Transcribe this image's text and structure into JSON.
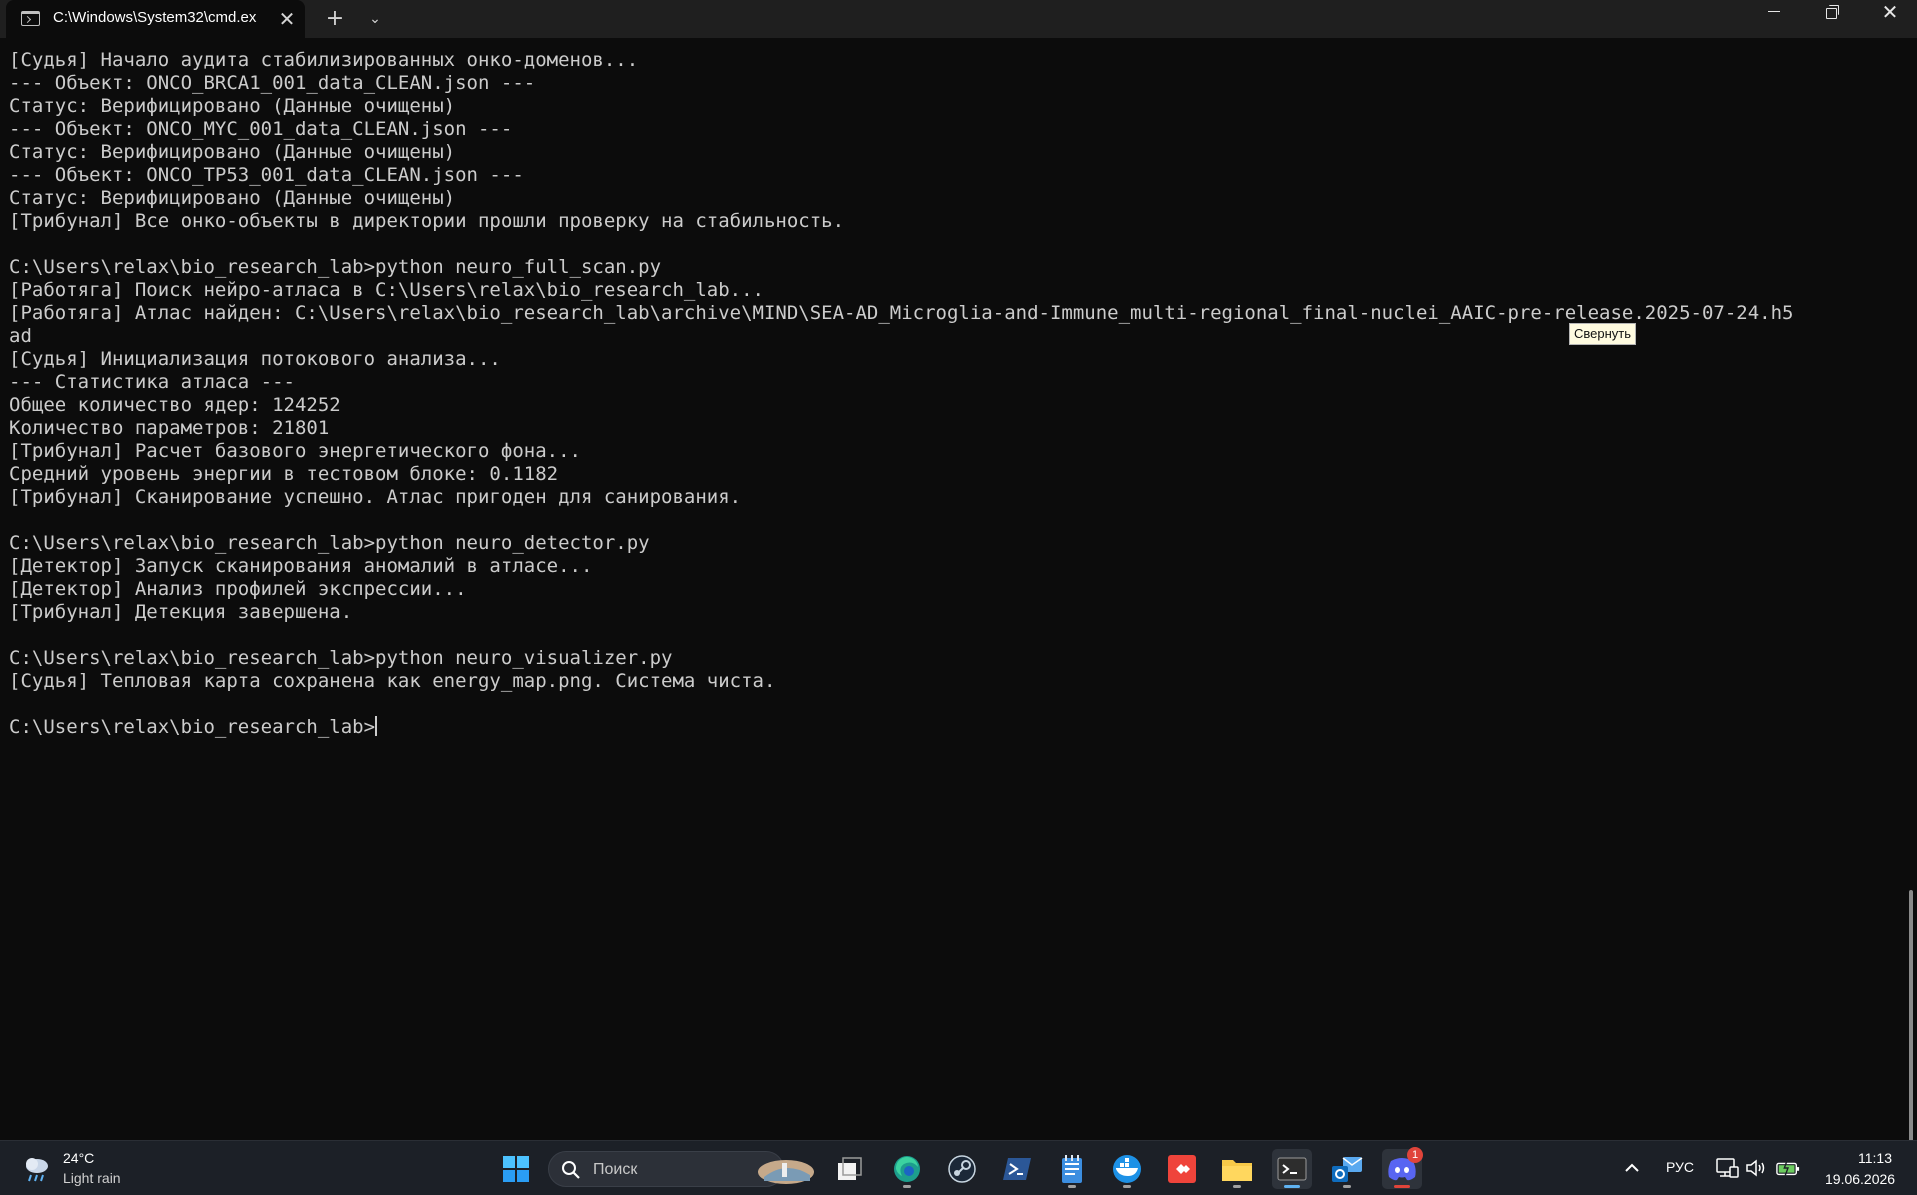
{
  "window": {
    "tab_title": "C:\\Windows\\System32\\cmd.ex",
    "close_glyph": "✕",
    "new_tab_glyph": "+",
    "dropdown_glyph": "⌄",
    "close_window_glyph": "✕"
  },
  "terminal": {
    "lines": [
      "[Судья] Начало аудита стабилизированных онко-доменов...",
      "--- Объект: ONCO_BRCA1_001_data_CLEAN.json ---",
      "Статус: Верифицировано (Данные очищены)",
      "--- Объект: ONCO_MYC_001_data_CLEAN.json ---",
      "Статус: Верифицировано (Данные очищены)",
      "--- Объект: ONCO_TP53_001_data_CLEAN.json ---",
      "Статус: Верифицировано (Данные очищены)",
      "[Трибунал] Все онко-объекты в директории прошли проверку на стабильность.",
      "",
      "C:\\Users\\relax\\bio_research_lab>python neuro_full_scan.py",
      "[Работяга] Поиск нейро-атласа в C:\\Users\\relax\\bio_research_lab...",
      "[Работяга] Атлас найден: C:\\Users\\relax\\bio_research_lab\\archive\\MIND\\SEA-AD_Microglia-and-Immune_multi-regional_final-nuclei_AAIC-pre-release.2025-07-24.h5",
      "ad",
      "[Судья] Инициализация потокового анализа...",
      "--- Статистика атласа ---",
      "Общее количество ядер: 124252",
      "Количество параметров: 21801",
      "[Трибунал] Расчет базового энергетического фона...",
      "Средний уровень энергии в тестовом блоке: 0.1182",
      "[Трибунал] Сканирование успешно. Атлас пригоден для санирования.",
      "",
      "C:\\Users\\relax\\bio_research_lab>python neuro_detector.py",
      "[Детектор] Запуск сканирования аномалий в атласе...",
      "[Детектор] Анализ профилей экспрессии...",
      "[Трибунал] Детекция завершена.",
      "",
      "C:\\Users\\relax\\bio_research_lab>python neuro_visualizer.py",
      "[Судья] Тепловая карта сохранена как energy_map.png. Система чиста.",
      "",
      "C:\\Users\\relax\\bio_research_lab>"
    ],
    "tooltip": "Свернуть"
  },
  "taskbar": {
    "weather_temp": "24°C",
    "weather_desc": "Light rain",
    "search_placeholder": "Поиск",
    "apps": [
      "windows-start",
      "search",
      "task-view",
      "edge",
      "steam",
      "powershell",
      "notepad",
      "docker",
      "anydesk",
      "file-explorer",
      "terminal",
      "outlook",
      "discord"
    ],
    "discord_badge": "1",
    "language": "РУС",
    "time": "11:13",
    "date": "19.06.2026",
    "accent_color": "#5fb2f2",
    "discord_color": "#5865f2"
  }
}
